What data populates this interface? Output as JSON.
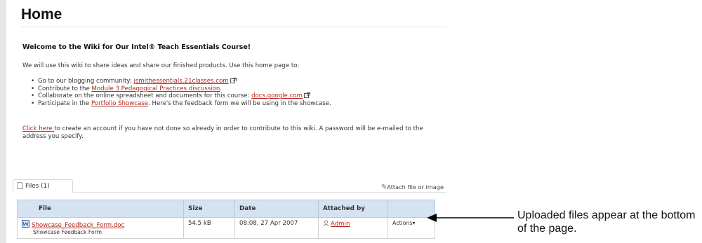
{
  "page": {
    "title": "Home",
    "welcome_heading": "Welcome to the Wiki for Our Intel® Teach Essentials Course!",
    "intro": "We will use this wiki to share ideas and share our finished products. Use this home page to:",
    "bullets": [
      {
        "pre": "Go to our blogging community: ",
        "link": "jsmithessentials.21classes.com",
        "post": "",
        "external": true
      },
      {
        "pre": "Contribute to the ",
        "link": "Module 3 Pedagogical Practices discussion",
        "post": ".",
        "external": false
      },
      {
        "pre": "Collaborate on the online spreadsheet and documents for this course: ",
        "link": "docs.google.com",
        "post": "",
        "external": true
      },
      {
        "pre": "Participate in the ",
        "link": "Portfolio Showcase",
        "post": ". Here's the feedback form we will be using in the showcase.",
        "external": false
      }
    ],
    "account_link": "Click here ",
    "account_text": "to create an account if you have not done so already in order to contribute to this wiki. A password will be e-mailed to the address you specify."
  },
  "files_panel": {
    "tab_label": "Files (1)",
    "attach_label": "Attach file or image",
    "columns": [
      "File",
      "Size",
      "Date",
      "Attached by",
      ""
    ],
    "rows": [
      {
        "file_name": "Showcase_Feedback_Form.doc",
        "file_desc": "Showcase Feedback Form",
        "size": "54.5 kB",
        "date": "08:08, 27 Apr 2007",
        "attached_by": "Admin",
        "actions": "Actions▾"
      }
    ]
  },
  "annotation": {
    "text": "Uploaded files appear at the bottom of the page."
  },
  "colors": {
    "link": "#b3261e",
    "table_header": "#d4e2f1"
  }
}
